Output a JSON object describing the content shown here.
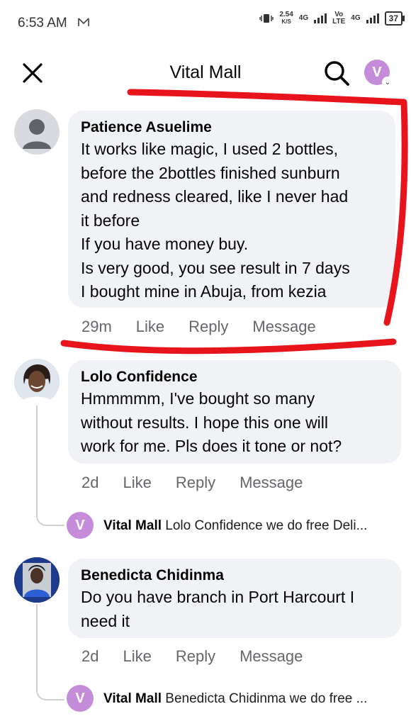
{
  "status_bar": {
    "time": "6:53 AM",
    "speed_value": "2.54",
    "speed_unit": "K/S",
    "net1": "4G",
    "net2_top": "Vo",
    "net2_bottom": "LTE",
    "net3": "4G",
    "battery": "37"
  },
  "header": {
    "title": "Vital Mall",
    "avatar_initial": "V"
  },
  "comments": [
    {
      "author": "Patience Asuelime",
      "lines": [
        "It works like magic, I used 2 bottles,",
        "before the 2bottles finished sunburn",
        "and redness cleared, like I never had",
        "it before",
        "If you have money buy.",
        "Is very good, you see result in 7 days",
        "I bought mine in Abuja, from kezia"
      ],
      "time": "29m",
      "like": "Like",
      "reply": "Reply",
      "message": "Message"
    },
    {
      "author": "Lolo Confidence",
      "lines": [
        "Hmmmmm, I've bought so many",
        "without results. I hope this one will",
        "work for me. Pls does it tone or not?"
      ],
      "time": "2d",
      "like": "Like",
      "reply": "Reply",
      "message": "Message",
      "reply_preview": {
        "avatar_initial": "V",
        "author": "Vital Mall",
        "text": "Lolo Confidence  we do free Deli..."
      }
    },
    {
      "author": "Benedicta Chidinma",
      "lines": [
        "Do you have branch in Port Harcourt I",
        "need it"
      ],
      "time": "2d",
      "like": "Like",
      "reply": "Reply",
      "message": "Message",
      "reply_preview": {
        "avatar_initial": "V",
        "author": "Vital Mall",
        "text": "Benedicta Chidinma we do free ..."
      }
    }
  ],
  "colors": {
    "bubble": "#f0f2f5",
    "annotation": "#e8141c",
    "brand_avatar": "#c58dd9",
    "secondary_text": "#65676b"
  }
}
